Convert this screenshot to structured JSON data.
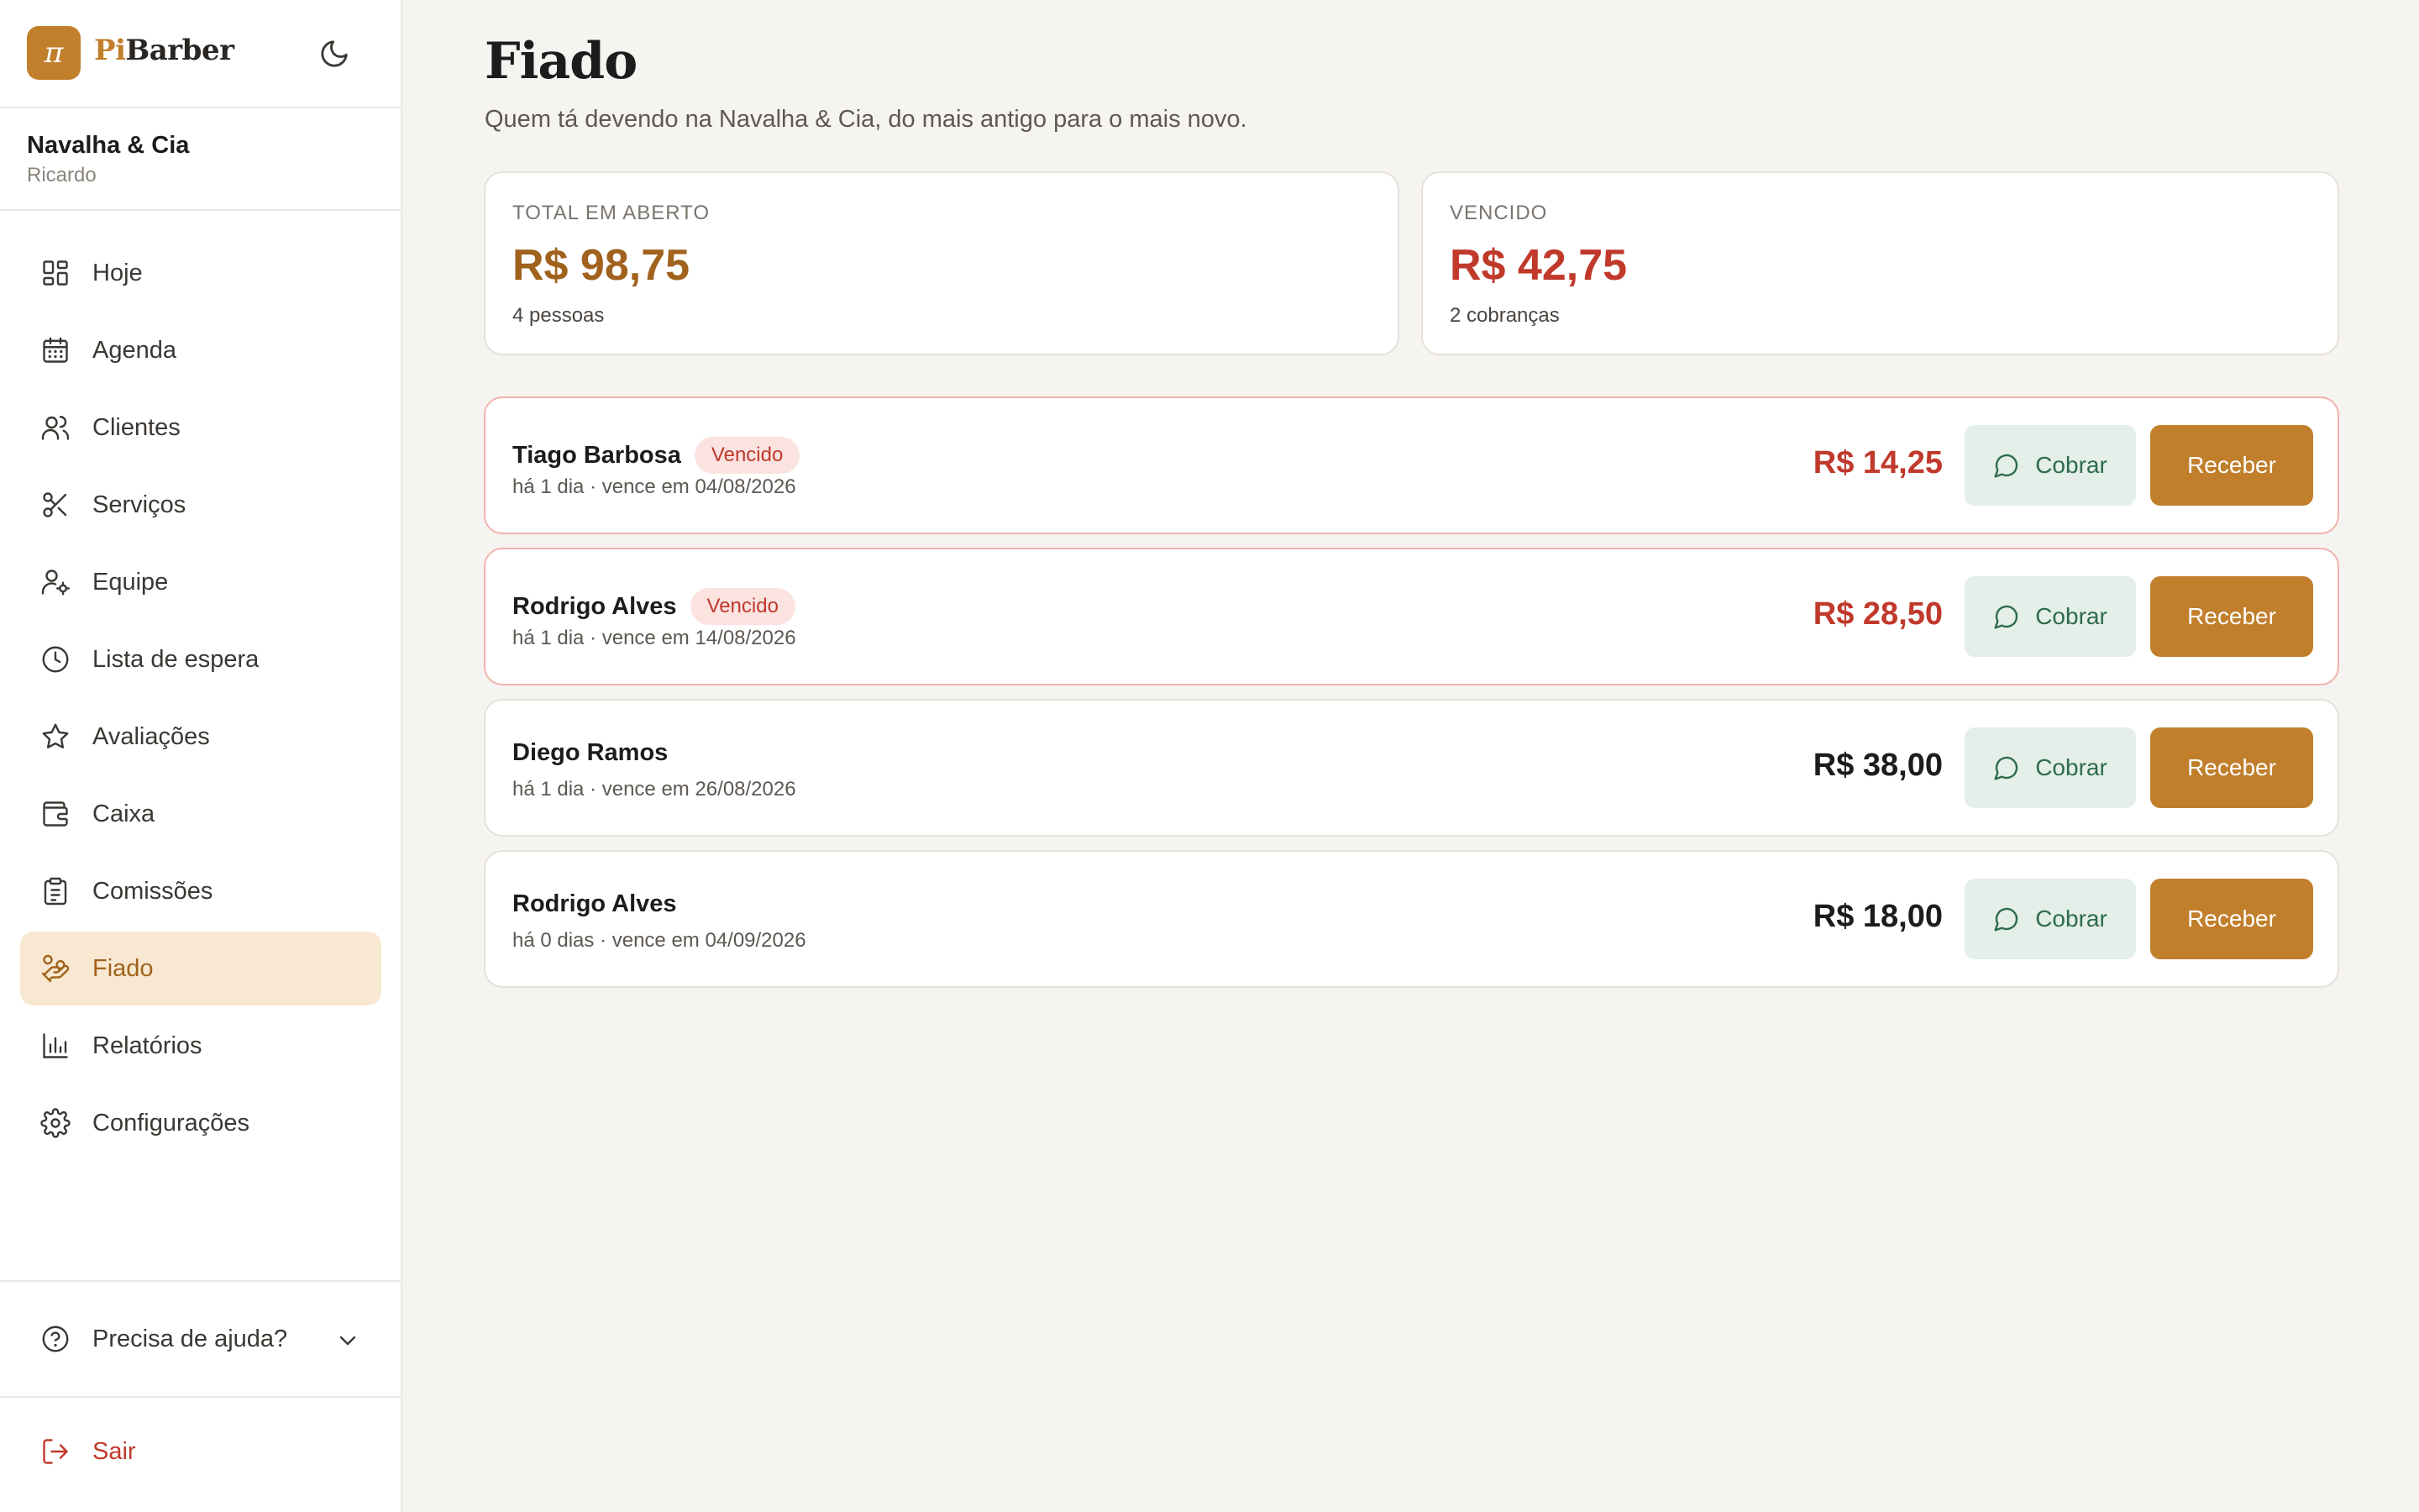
{
  "brand": {
    "logo_glyph": "π",
    "name_prefix": "Pi",
    "name_suffix": "Barber",
    "accent": "#c17f2c"
  },
  "shop": {
    "name": "Navalha & Cia",
    "user": "Ricardo"
  },
  "nav": [
    {
      "label": "Hoje",
      "icon": "grid-icon"
    },
    {
      "label": "Agenda",
      "icon": "calendar-icon"
    },
    {
      "label": "Clientes",
      "icon": "users-icon"
    },
    {
      "label": "Serviços",
      "icon": "scissors-icon"
    },
    {
      "label": "Equipe",
      "icon": "user-cog-icon"
    },
    {
      "label": "Lista de espera",
      "icon": "clock-icon"
    },
    {
      "label": "Avaliações",
      "icon": "star-icon"
    },
    {
      "label": "Caixa",
      "icon": "wallet-icon"
    },
    {
      "label": "Comissões",
      "icon": "clipboard-icon"
    },
    {
      "label": "Fiado",
      "icon": "hand-coins-icon",
      "active": true
    },
    {
      "label": "Relatórios",
      "icon": "bar-chart-icon"
    },
    {
      "label": "Configurações",
      "icon": "gear-icon"
    }
  ],
  "help": {
    "label": "Precisa de ajuda?"
  },
  "logout": {
    "label": "Sair"
  },
  "page": {
    "title": "Fiado",
    "subtitle": "Quem tá devendo na Navalha & Cia, do mais antigo para o mais novo."
  },
  "stats": {
    "total": {
      "label": "TOTAL EM ABERTO",
      "value": "R$ 98,75",
      "sub": "4 pessoas"
    },
    "overdue": {
      "label": "VENCIDO",
      "value": "R$ 42,75",
      "sub": "2 cobranças"
    }
  },
  "actions": {
    "cobrar": "Cobrar",
    "receber": "Receber"
  },
  "debts": [
    {
      "name": "Tiago Barbosa",
      "badge": "Vencido",
      "meta": "há 1 dia · vence em 04/08/2026",
      "amount": "R$ 14,25",
      "overdue": true
    },
    {
      "name": "Rodrigo Alves",
      "badge": "Vencido",
      "meta": "há 1 dia · vence em 14/08/2026",
      "amount": "R$ 28,50",
      "overdue": true
    },
    {
      "name": "Diego Ramos",
      "badge": "",
      "meta": "há 1 dia · vence em 26/08/2026",
      "amount": "R$ 38,00",
      "overdue": false
    },
    {
      "name": "Rodrigo Alves",
      "badge": "",
      "meta": "há 0 dias · vence em 04/09/2026",
      "amount": "R$ 18,00",
      "overdue": false
    }
  ],
  "colors": {
    "overdue_red": "#c0392b",
    "cobrar_bg": "#e3efe8",
    "receber_bg": "#c17f2c",
    "active_nav_bg": "#f8e8d2"
  }
}
